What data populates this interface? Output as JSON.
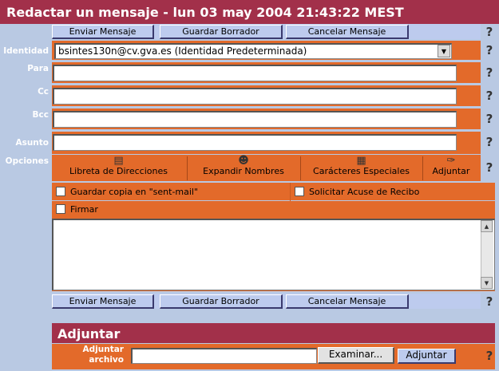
{
  "header": {
    "title": "Redactar un mensaje - lun 03 may 2004 21:43:22 MEST"
  },
  "toolbar": {
    "send_label": "Enviar Mensaje",
    "save_draft_label": "Guardar Borrador",
    "cancel_label": "Cancelar Mensaje",
    "help_label": "?"
  },
  "fields": {
    "identity": {
      "label": "Identidad",
      "value": "bsintes130n@cv.gva.es (Identidad Predeterminada)"
    },
    "to": {
      "label": "Para",
      "value": ""
    },
    "cc": {
      "label": "Cc",
      "value": ""
    },
    "bcc": {
      "label": "Bcc",
      "value": ""
    },
    "subject": {
      "label": "Asunto",
      "value": ""
    }
  },
  "options": {
    "label": "Opciones",
    "address_book": "Libreta de Direcciones",
    "expand_names": "Expandir Nombres",
    "special_chars": "Carácteres Especiales",
    "attach": "Adjuntar"
  },
  "checkboxes": {
    "save_copy": "Guardar copia en \"sent-mail\"",
    "read_receipt": "Solicitar Acuse de Recibo",
    "sign": "Firmar"
  },
  "attachments": {
    "section_title": "Adjuntar",
    "file_label_line1": "Adjuntar",
    "file_label_line2": "archivo",
    "browse_label": "Examinar...",
    "attach_button": "Adjuntar"
  },
  "icons": {
    "address_book": "book-icon",
    "expand_names": "people-icon",
    "special_chars": "keyboard-icon",
    "attach": "paperclip-icon"
  },
  "colors": {
    "title_bg": "#a2304a",
    "form_bg": "#e36a2a",
    "page_bg": "#b9c9e3",
    "button_bg": "#bdcbee"
  }
}
